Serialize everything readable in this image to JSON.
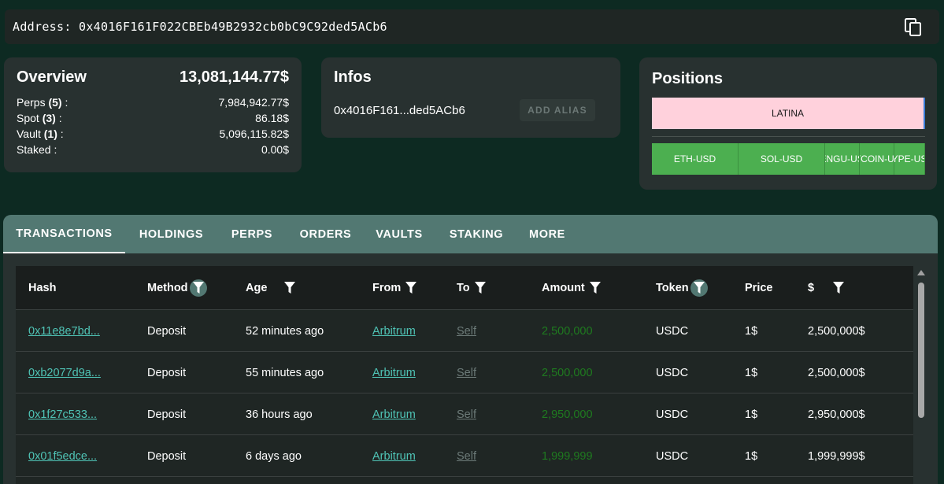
{
  "address": {
    "label": "Address:",
    "value": "0x4016F161F022CBEb49B2932cb0bC9C92ded5ACb6"
  },
  "overview": {
    "title": "Overview",
    "total": "13,081,144.77$",
    "rows": [
      {
        "label": "Perps",
        "count": "(5)",
        "suffix": " :",
        "value": "7,984,942.77$"
      },
      {
        "label": "Spot",
        "count": "(3)",
        "suffix": " :",
        "value": "86.18$"
      },
      {
        "label": "Vault",
        "count": "(1)",
        "suffix": " :",
        "value": "5,096,115.82$"
      },
      {
        "label": "Staked",
        "count": "",
        "suffix": " :",
        "value": "0.00$"
      }
    ]
  },
  "infos": {
    "title": "Infos",
    "short_address": "0x4016F161...ded5ACb6",
    "alias_button": "ADD ALIAS"
  },
  "positions": {
    "title": "Positions",
    "vault": "LATINA",
    "items": [
      "ETH-USD",
      "SOL-USD",
      "PENGU-USD",
      "BITCOIN-USD",
      "HYPE-USD"
    ],
    "colors": {
      "vault": "#ffd1dc",
      "item": "#4caf50"
    }
  },
  "tabs": [
    "TRANSACTIONS",
    "HOLDINGS",
    "PERPS",
    "ORDERS",
    "VAULTS",
    "STAKING",
    "MORE"
  ],
  "table": {
    "headers": [
      "Hash",
      "Method",
      "Age",
      "From",
      "To",
      "Amount",
      "Token",
      "Price",
      "$"
    ],
    "rows": [
      {
        "hash": "0x11e8e7bd...",
        "method": "Deposit",
        "age": "52 minutes ago",
        "from": "Arbitrum",
        "to": "Self",
        "amount": "2,500,000",
        "token": "USDC",
        "price": "1$",
        "usd": "2,500,000$"
      },
      {
        "hash": "0xb2077d9a...",
        "method": "Deposit",
        "age": "55 minutes ago",
        "from": "Arbitrum",
        "to": "Self",
        "amount": "2,500,000",
        "token": "USDC",
        "price": "1$",
        "usd": "2,500,000$"
      },
      {
        "hash": "0x1f27c533...",
        "method": "Deposit",
        "age": "36 hours ago",
        "from": "Arbitrum",
        "to": "Self",
        "amount": "2,950,000",
        "token": "USDC",
        "price": "1$",
        "usd": "2,950,000$"
      },
      {
        "hash": "0x01f5edce...",
        "method": "Deposit",
        "age": "6 days ago",
        "from": "Arbitrum",
        "to": "Self",
        "amount": "1,999,999",
        "token": "USDC",
        "price": "1$",
        "usd": "1,999,999$"
      }
    ]
  },
  "icons": {
    "copy": "copy-icon",
    "filter": "filter-icon"
  }
}
